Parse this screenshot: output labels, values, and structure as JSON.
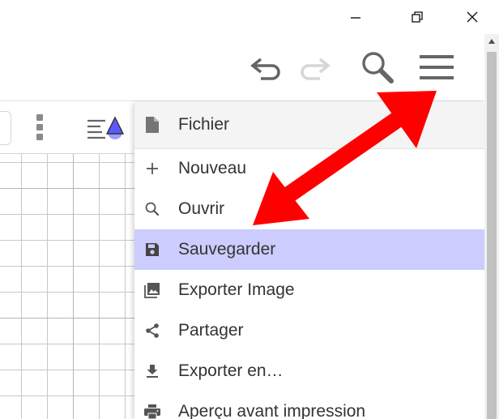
{
  "titlebar": {
    "minimize_glyph": "—",
    "close_glyph": "✕"
  },
  "toolbar": {
    "icons": [
      "undo-icon",
      "redo-icon",
      "search-icon",
      "hamburger-menu-icon"
    ]
  },
  "menu": {
    "header": {
      "label": "Fichier",
      "icon": "file-icon"
    },
    "items": [
      {
        "label": "Nouveau",
        "icon": "plus-icon",
        "selected": false
      },
      {
        "label": "Ouvrir",
        "icon": "search-icon",
        "selected": false
      },
      {
        "label": "Sauvegarder",
        "icon": "floppy-disk-icon",
        "selected": true
      },
      {
        "label": "Exporter Image",
        "icon": "image-icon",
        "selected": false
      },
      {
        "label": "Partager",
        "icon": "share-icon",
        "selected": false
      },
      {
        "label": "Exporter en…",
        "icon": "download-icon",
        "selected": false
      },
      {
        "label": "Aperçu avant impression",
        "icon": "printer-icon",
        "selected": false
      }
    ]
  },
  "colors": {
    "selected_row": "#ccccff",
    "menu_header_bg": "#f4f4f4",
    "icon_gray": "#666666",
    "annotation_arrow": "#ff0000",
    "style_icon_accent": "#7b7bff"
  }
}
